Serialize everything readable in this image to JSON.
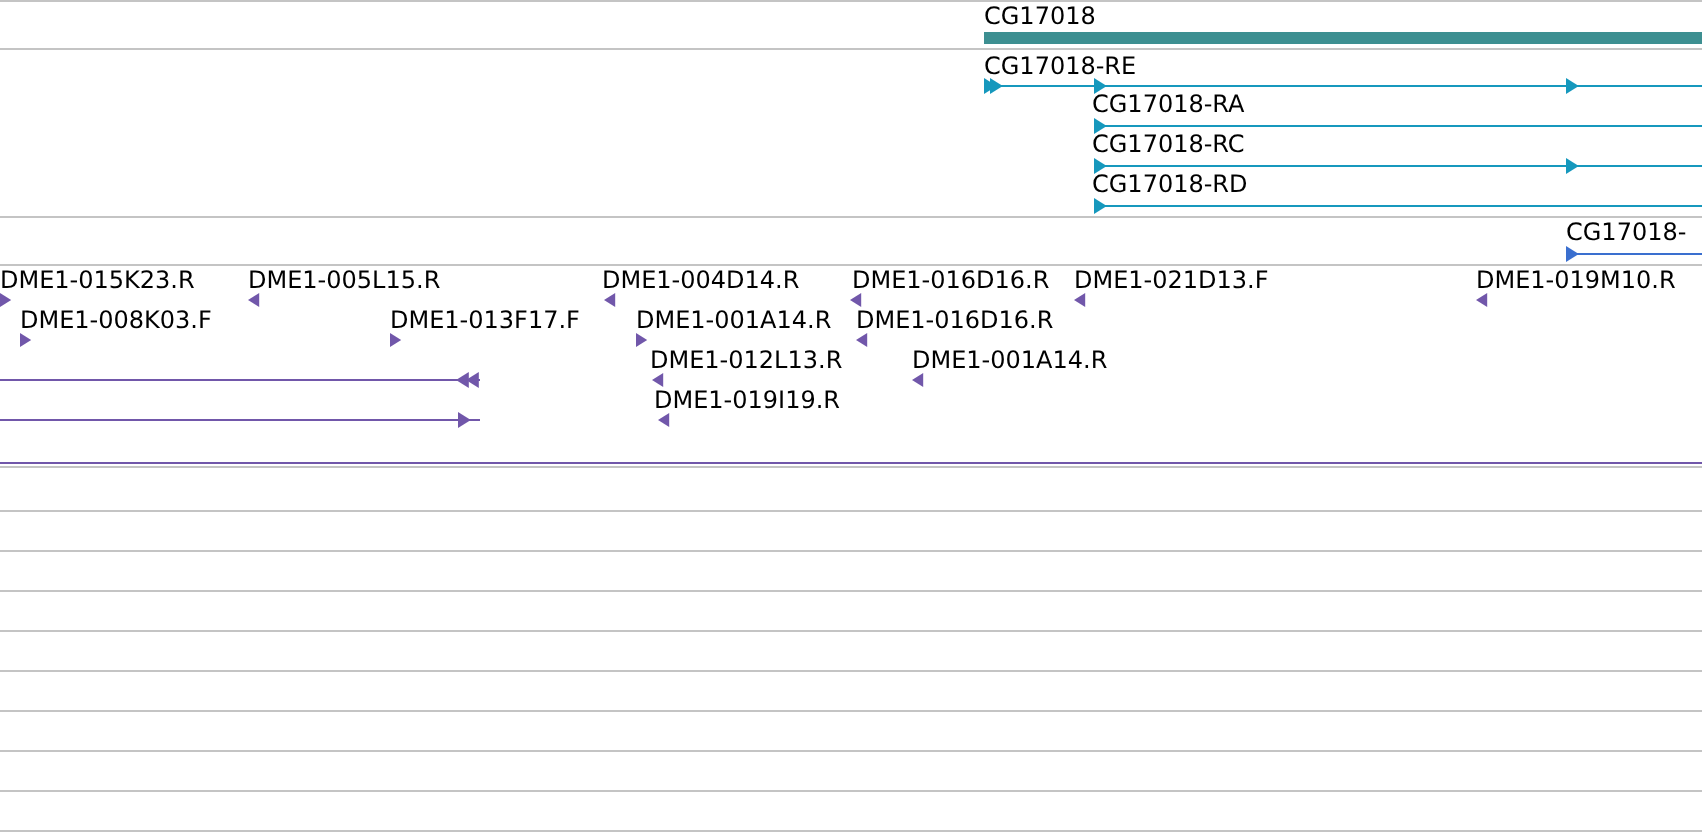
{
  "gene_track": {
    "features": [
      {
        "label": "CG17018"
      }
    ]
  },
  "transcript_track": {
    "features": [
      {
        "label": "CG17018-RE",
        "reverse": false
      },
      {
        "label": "CG17018-RA",
        "reverse": false
      },
      {
        "label": "CG17018-RC",
        "reverse": false
      },
      {
        "label": "CG17018-RD",
        "reverse": false
      }
    ]
  },
  "partial_track": {
    "features": [
      {
        "label": "CG17018-",
        "reverse": false
      }
    ]
  },
  "clone_track": {
    "features": [
      {
        "label": "DME1-015K23.R",
        "reverse": false
      },
      {
        "label": "DME1-005L15.R",
        "reverse": true
      },
      {
        "label": "DME1-004D14.R",
        "reverse": true
      },
      {
        "label": "DME1-016D16.R",
        "reverse": true
      },
      {
        "label": "DME1-021D13.F",
        "reverse": true
      },
      {
        "label": "DME1-019M10.R",
        "reverse": true
      },
      {
        "label": "DME1-008K03.F",
        "reverse": false
      },
      {
        "label": "DME1-013F17.F",
        "reverse": false
      },
      {
        "label": "DME1-001A14.R",
        "reverse": false
      },
      {
        "label": "DME1-016D16.R",
        "reverse": true
      },
      {
        "label": "DME1-012L13.R",
        "reverse": true
      },
      {
        "label": "DME1-001A14.R",
        "reverse": true
      },
      {
        "label": "DME1-019I19.R",
        "reverse": true
      }
    ],
    "unlabeled_features": [
      {
        "reverse": true
      },
      {
        "reverse": false
      }
    ]
  }
}
